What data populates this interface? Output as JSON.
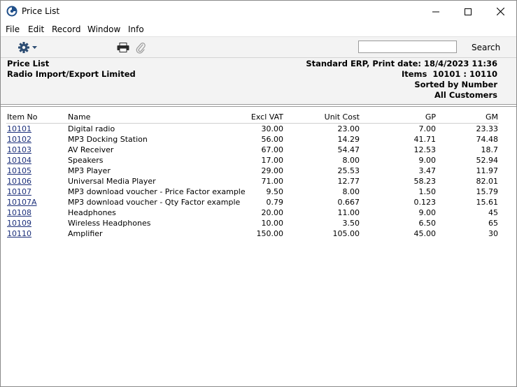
{
  "window": {
    "title": "Price List"
  },
  "menu": {
    "items": [
      "File",
      "Edit",
      "Record",
      "Window",
      "Info"
    ]
  },
  "toolbar": {
    "search_label": "Search",
    "search_value": ""
  },
  "report": {
    "title": "Price List",
    "company": "Radio Import/Export Limited",
    "print_info": "Standard ERP, Print date: 18/4/2023 11:36",
    "items_range": "Items  10101 : 10110",
    "sorted_by": "Sorted by Number",
    "customers": "All Customers"
  },
  "table": {
    "columns": [
      "Item No",
      "Name",
      "Excl VAT",
      "Unit Cost",
      "GP",
      "GM"
    ],
    "rows": [
      [
        "10101",
        "Digital radio",
        "30.00",
        "23.00",
        "7.00",
        "23.33"
      ],
      [
        "10102",
        "MP3 Docking Station",
        "56.00",
        "14.29",
        "41.71",
        "74.48"
      ],
      [
        "10103",
        "AV Receiver",
        "67.00",
        "54.47",
        "12.53",
        "18.7"
      ],
      [
        "10104",
        "Speakers",
        "17.00",
        "8.00",
        "9.00",
        "52.94"
      ],
      [
        "10105",
        "MP3 Player",
        "29.00",
        "25.53",
        "3.47",
        "11.97"
      ],
      [
        "10106",
        "Universal Media Player",
        "71.00",
        "12.77",
        "58.23",
        "82.01"
      ],
      [
        "10107",
        "MP3 download voucher - Price Factor example",
        "9.50",
        "8.00",
        "1.50",
        "15.79"
      ],
      [
        "10107A",
        "MP3 download voucher - Qty Factor example",
        "0.79",
        "0.667",
        "0.123",
        "15.61"
      ],
      [
        "10108",
        "Headphones",
        "20.00",
        "11.00",
        "9.00",
        "45"
      ],
      [
        "10109",
        "Wireless Headphones",
        "10.00",
        "3.50",
        "6.50",
        "65"
      ],
      [
        "10110",
        "Amplifier",
        "150.00",
        "105.00",
        "45.00",
        "30"
      ]
    ]
  }
}
